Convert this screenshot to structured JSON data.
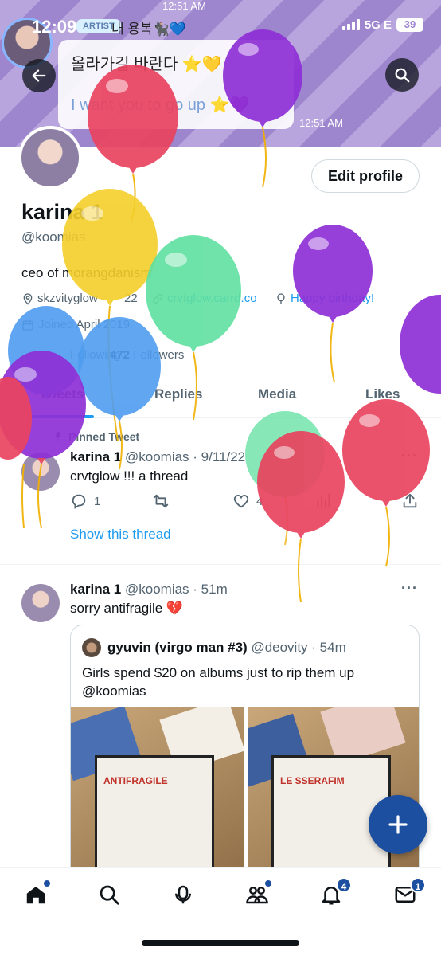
{
  "status_bar": {
    "time": "12:09",
    "network": "5G E",
    "battery": "39"
  },
  "banner_chat": {
    "tag": "ARTIST",
    "sender": "내 용복🐈‍⬛💙",
    "top_time": "12:51 AM",
    "message_kr": "올라가길 바란다 ⭐💛",
    "message_en": "I want you to go up ⭐💜",
    "time": "12:51 AM"
  },
  "profile": {
    "display_name": "karina 1",
    "handle": "@koomias",
    "edit_button": "Edit profile",
    "bio": "ceo of morangdanism",
    "location": "skzvityglow",
    "location_suffix": "22",
    "link": "crvtglow.carrd.co",
    "birthday": "Happy birthday!",
    "joined": "Joined April 2019",
    "following_label": "Following",
    "followers_count": "472",
    "followers_label": "Followers"
  },
  "tabs": [
    {
      "label": "Tweets",
      "active": true
    },
    {
      "label": "Replies",
      "active": false
    },
    {
      "label": "Media",
      "active": false
    },
    {
      "label": "Likes",
      "active": false
    }
  ],
  "pinned_tweet": {
    "pinned_label": "Pinned Tweet",
    "name": "karina 1",
    "meta": "@koomias · 9/11/22",
    "text": "crvtglow !!! a thread",
    "replies": "1",
    "likes": "4",
    "show_thread": "Show this thread"
  },
  "tweet": {
    "name": "karina 1",
    "meta": "@koomias · 51m",
    "text": "sorry antifragile 💔",
    "quote": {
      "name": "gyuvin (virgo man #3)",
      "meta": "@deovity · 54m",
      "text": "Girls spend $20 on albums just to rip them up @koomias",
      "image_text_left": "ANTIFRAGILE",
      "image_text_right": "LE SSERAFIM"
    }
  },
  "bottom_nav": {
    "notifications_badge": "4",
    "messages_badge": "1"
  },
  "colors": {
    "accent": "#1d9bf0",
    "fab": "#1d4fa0",
    "banner": "#9d86cd"
  }
}
